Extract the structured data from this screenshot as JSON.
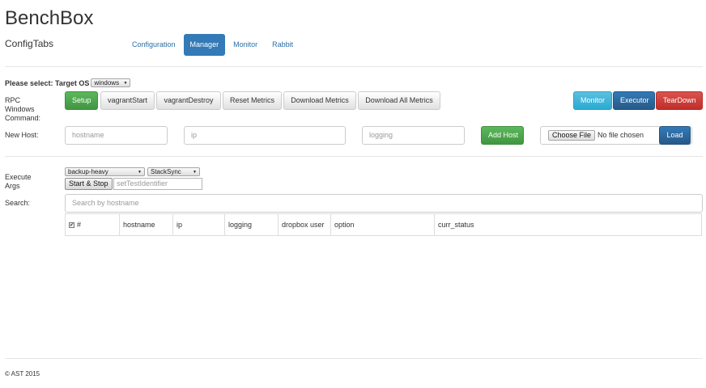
{
  "header": {
    "brand": "BenchBox",
    "subtitle": "ConfigTabs",
    "tabs": [
      {
        "label": "Configuration",
        "active": false
      },
      {
        "label": "Manager",
        "active": true
      },
      {
        "label": "Monitor",
        "active": false
      },
      {
        "label": "Rabbit",
        "active": false
      }
    ]
  },
  "target_os": {
    "label": "Please select: Target OS",
    "selected": "windows"
  },
  "rpc": {
    "label": "RPC Windows Command:",
    "buttons": {
      "setup": "Setup",
      "vagrant_start": "vagrantStart",
      "vagrant_destroy": "vagrantDestroy",
      "reset_metrics": "Reset Metrics",
      "download_metrics": "Download Metrics",
      "download_all_metrics": "Download All Metrics"
    },
    "right_buttons": {
      "monitor": "Monitor",
      "executor": "Executor",
      "teardown": "TearDown"
    }
  },
  "new_host": {
    "label": "New Host:",
    "hostname_placeholder": "hostname",
    "ip_placeholder": "ip",
    "logging_placeholder": "logging",
    "add_button": "Add Host",
    "choose_file": "Choose File",
    "file_status": "No file chosen",
    "load_button": "Load"
  },
  "execute": {
    "label": "Execute Args",
    "profile_selected": "backup-heavy",
    "service_selected": "StackSync",
    "start_stop": "Start & Stop",
    "test_id_placeholder": "setTestIdentifier"
  },
  "search": {
    "label": "Search:",
    "placeholder": "Search by hostname"
  },
  "table": {
    "columns": [
      "#",
      "hostname",
      "ip",
      "logging",
      "dropbox user",
      "option",
      "curr_status"
    ],
    "select_all_checked": true
  },
  "footer": {
    "text": "© AST 2015"
  },
  "colors": {
    "primary": "#337ab7",
    "success": "#5cb85c",
    "info": "#5bc0de",
    "danger": "#d9534f"
  }
}
